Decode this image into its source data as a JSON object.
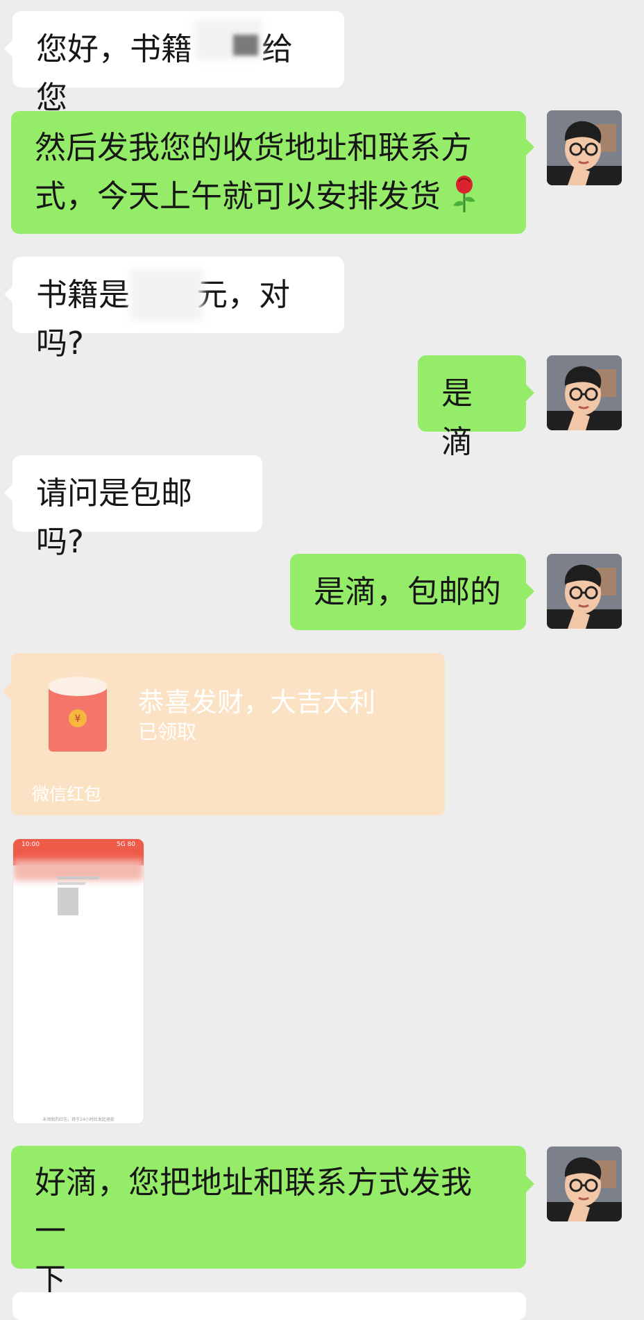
{
  "colors": {
    "background": "#ededed",
    "incoming": "#ffffff",
    "outgoing": "#95ec69",
    "red_packet": "#fbe2c5"
  },
  "messages": [
    {
      "side": "left",
      "text": "您好，书籍",
      "text_after": "给您"
    },
    {
      "side": "right",
      "line1": "然后发我您的收货地址和联系方",
      "line2": "式，今天上午就可以安排发货",
      "emoji": "rose-icon"
    },
    {
      "side": "left",
      "text": "书籍是",
      "text_after": "元，对吗?"
    },
    {
      "side": "right",
      "text": "是滴"
    },
    {
      "side": "left",
      "text": "请问是包邮吗?"
    },
    {
      "side": "right",
      "text": "是滴，包邮的"
    },
    {
      "side": "right",
      "line1": "好滴，您把地址和联系方式发我一",
      "line2": "下"
    }
  ],
  "red_packet": {
    "title": "恭喜发财，大吉大利",
    "status": "已领取",
    "footer": "微信红包",
    "icon": "red-envelope-icon"
  },
  "screenshot_thumb": {
    "time": "10:00",
    "status": "5G 80",
    "footer": "未领取的红包，将于24小时后发起退款"
  },
  "avatar": {
    "icon": "user-avatar-icon"
  }
}
